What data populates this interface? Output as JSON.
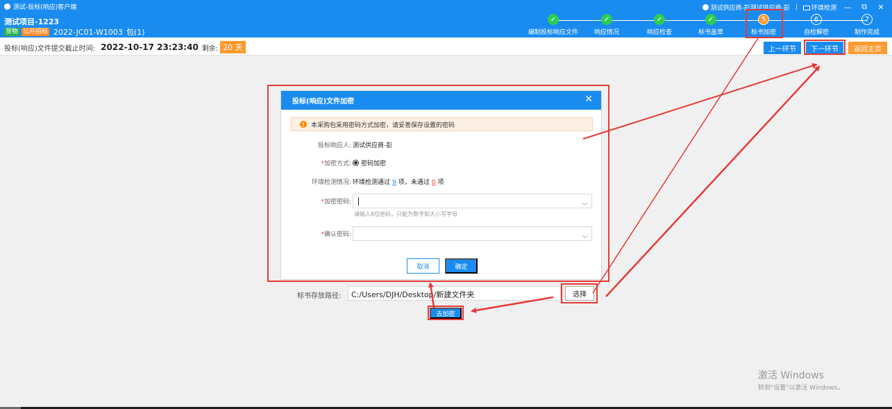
{
  "window": {
    "title": "测试-投标(响应)客户端",
    "user": "测试供应商-彭测试供应商-彭",
    "env_check": "环境检测",
    "minimize": "—",
    "restore": "⧉",
    "close": "✕"
  },
  "project": {
    "name": "测试项目-1223",
    "tag_goods": "货物",
    "tag_public": "公开招标",
    "code": "2022-JC01-W1003",
    "package": "包(1)"
  },
  "steps": [
    {
      "label": "编制投标响应文件",
      "state": "done",
      "mark": "✓"
    },
    {
      "label": "响应情况",
      "state": "done",
      "mark": "✓"
    },
    {
      "label": "响应检查",
      "state": "done",
      "mark": "✓"
    },
    {
      "label": "标书盖章",
      "state": "done",
      "mark": "✓"
    },
    {
      "label": "标书加密",
      "state": "current",
      "mark": "5"
    },
    {
      "label": "自检解密",
      "state": "todo",
      "mark": "6"
    },
    {
      "label": "制作完成",
      "state": "todo",
      "mark": "7"
    }
  ],
  "deadline": {
    "label": "投标(响应)文件提交截止时间:",
    "datetime": "2022-10-17 23:23:40",
    "remaining_label": "剩余:",
    "remaining": "20 天"
  },
  "nav": {
    "prev": "上一环节",
    "next": "下一环节",
    "home": "返回主页"
  },
  "dialog": {
    "title": "投标(响应)文件加密",
    "close": "✕",
    "notice": "本采购包采用密码方式加密，请妥善保存设置的密码",
    "responder_label": "投标响应人:",
    "responder": "测试供应商-彭",
    "method_label": "加密方式:",
    "method": "密码加密",
    "env_label": "环境检测情况:",
    "env_prefix": "环境检测通过",
    "env_pass": "9",
    "env_mid": "项，未通过",
    "env_fail": "0",
    "env_suffix": "项",
    "password_label": "加密密码:",
    "password_hint": "请输入8位密码，只能为数字和大小写字母",
    "confirm_label": "确认密码:",
    "eye": "◡",
    "cancel": "取消",
    "ok": "确定"
  },
  "storage": {
    "label": "标书存放路径:",
    "path": "C:/Users/DJH/Desktop/新建文件夹",
    "choose": "选择",
    "encrypt": "去加密"
  },
  "watermark": {
    "line1": "激活 Windows",
    "line2": "转到\"设置\"以激活 Windows。"
  },
  "colors": {
    "primary": "#1a8cf0",
    "accent_orange": "#ff9a2e",
    "done_green": "#2ecc55",
    "annotation_red": "#e53935"
  }
}
